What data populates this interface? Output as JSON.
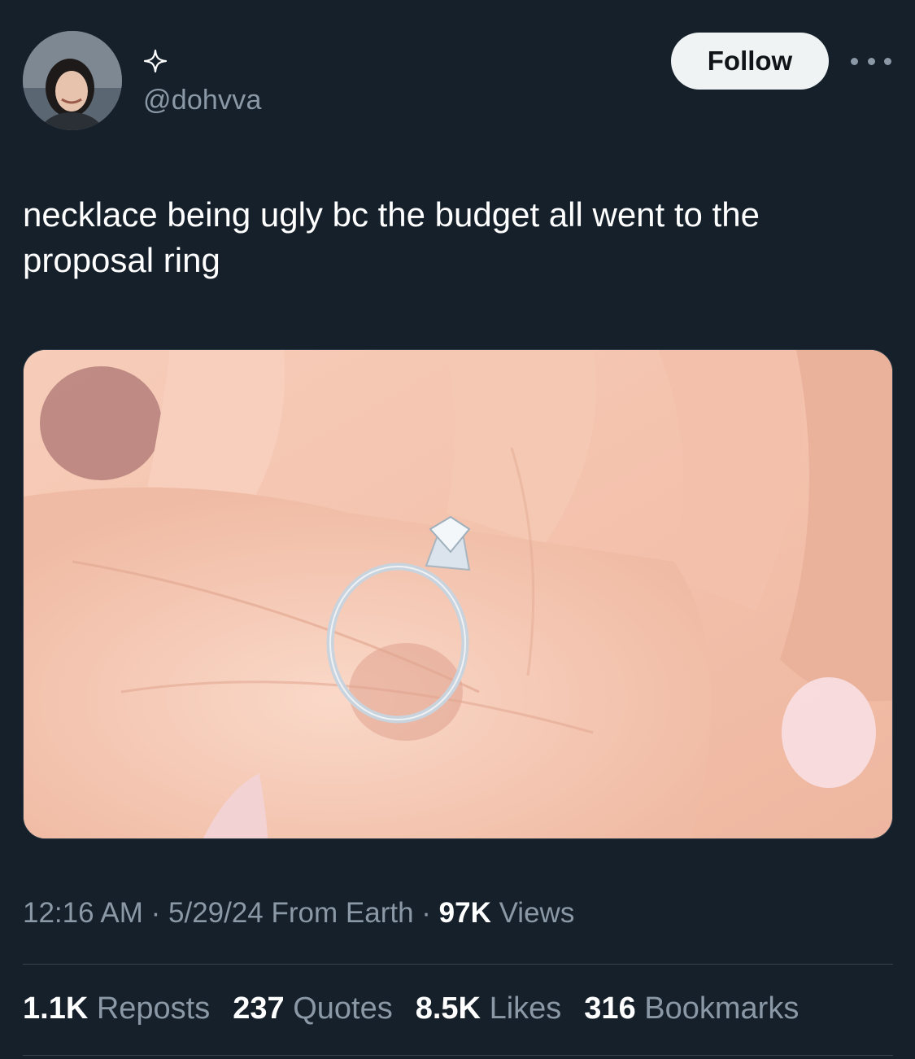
{
  "author": {
    "display_name_icon": "sparkle-icon",
    "handle": "@dohvva",
    "avatar_icon": "avatar"
  },
  "follow_label": "Follow",
  "more_icon": "more-horizontal-icon",
  "tweet": {
    "text": "necklace being ugly bc the budget all went to the proposal ring",
    "media_description_icon": "photo"
  },
  "meta": {
    "time": "12:16 AM",
    "sep1": " · ",
    "date": "5/29/24",
    "source": " From Earth",
    "sep2": " · ",
    "views_count": "97K",
    "views_label": " Views"
  },
  "stats": {
    "reposts_count": "1.1K",
    "reposts_label": " Reposts",
    "quotes_count": "237",
    "quotes_label": " Quotes",
    "likes_count": "8.5K",
    "likes_label": " Likes",
    "bookmarks_count": "316",
    "bookmarks_label": " Bookmarks"
  },
  "colors": {
    "background": "#15202b",
    "secondary_text": "#8b98a5",
    "follow_bg": "#eff3f4",
    "divider": "#38444d"
  }
}
